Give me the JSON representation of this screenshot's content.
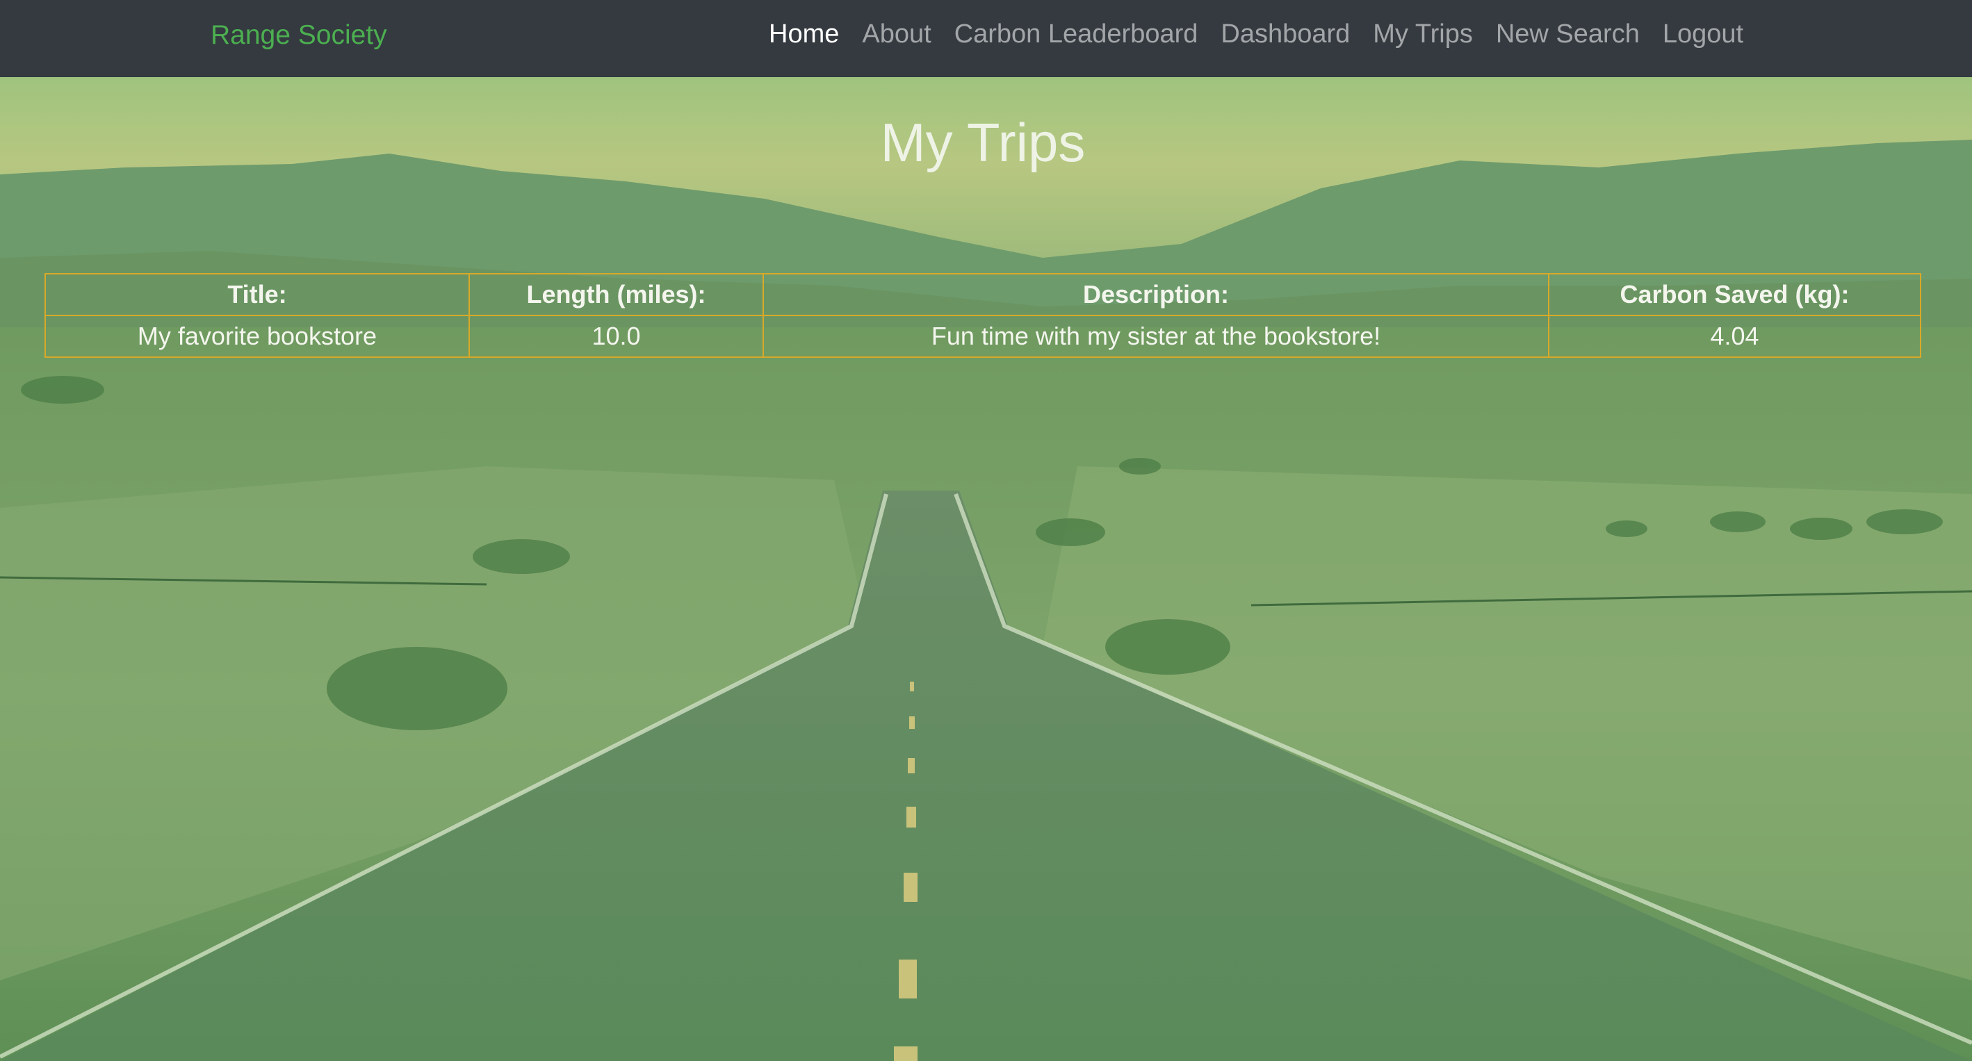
{
  "navbar": {
    "brand": "Range Society",
    "links": [
      {
        "label": "Home",
        "active": true
      },
      {
        "label": "About",
        "active": false
      },
      {
        "label": "Carbon Leaderboard",
        "active": false
      },
      {
        "label": "Dashboard",
        "active": false
      },
      {
        "label": "My Trips",
        "active": false
      },
      {
        "label": "New Search",
        "active": false
      },
      {
        "label": "Logout",
        "active": false
      }
    ]
  },
  "page": {
    "title": "My Trips"
  },
  "trips_table": {
    "headers": [
      "Title:",
      "Length (miles):",
      "Description:",
      "Carbon Saved (kg):"
    ],
    "rows": [
      [
        "My favorite bookstore",
        "10.0",
        "Fun time with my sister at the bookstore!",
        "4.04"
      ]
    ]
  },
  "colors": {
    "navbar_bg": "#343a40",
    "brand": "#4caf50",
    "nav_active": "#ffffff",
    "nav_inactive": "rgba(255,255,255,0.55)",
    "table_border": "#d9a928",
    "green_overlay": "#4f8a4a"
  }
}
